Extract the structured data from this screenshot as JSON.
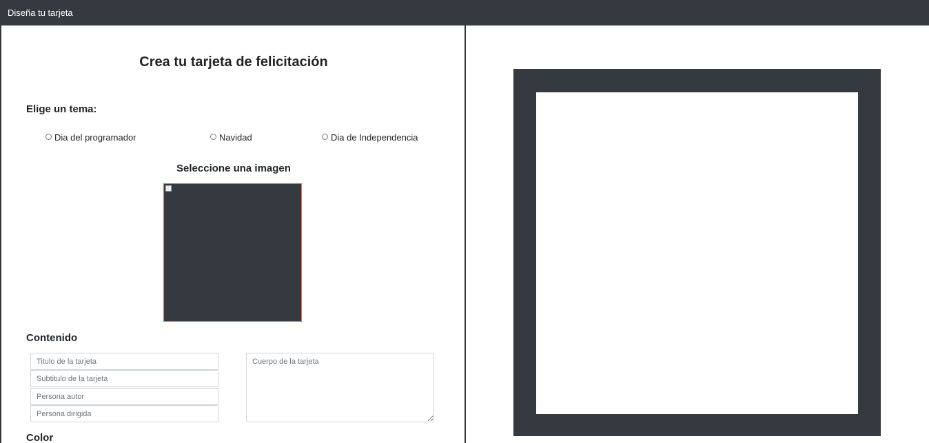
{
  "navbar": {
    "brand": "Diseña tu tarjeta"
  },
  "form": {
    "title": "Crea tu tarjeta de felicitación",
    "theme_heading": "Elige un tema:",
    "themes": [
      {
        "label": "Dia del programador"
      },
      {
        "label": "Navidad"
      },
      {
        "label": "Dia de Independencia"
      }
    ],
    "image_heading": "Seleccione una imagen",
    "content_heading": "Contenido",
    "inputs": {
      "title_placeholder": "Titulo de la tarjeta",
      "subtitle_placeholder": "Subtitulo de la tarjeta",
      "author_placeholder": "Persona autor",
      "recipient_placeholder": "Persona dirigida",
      "body_placeholder": "Cuerpo de la tarjeta"
    },
    "color_heading": "Color"
  },
  "colors": {
    "navbar_bg": "#343a40",
    "card_frame": "#343a40",
    "image_border": "#d9734f"
  }
}
